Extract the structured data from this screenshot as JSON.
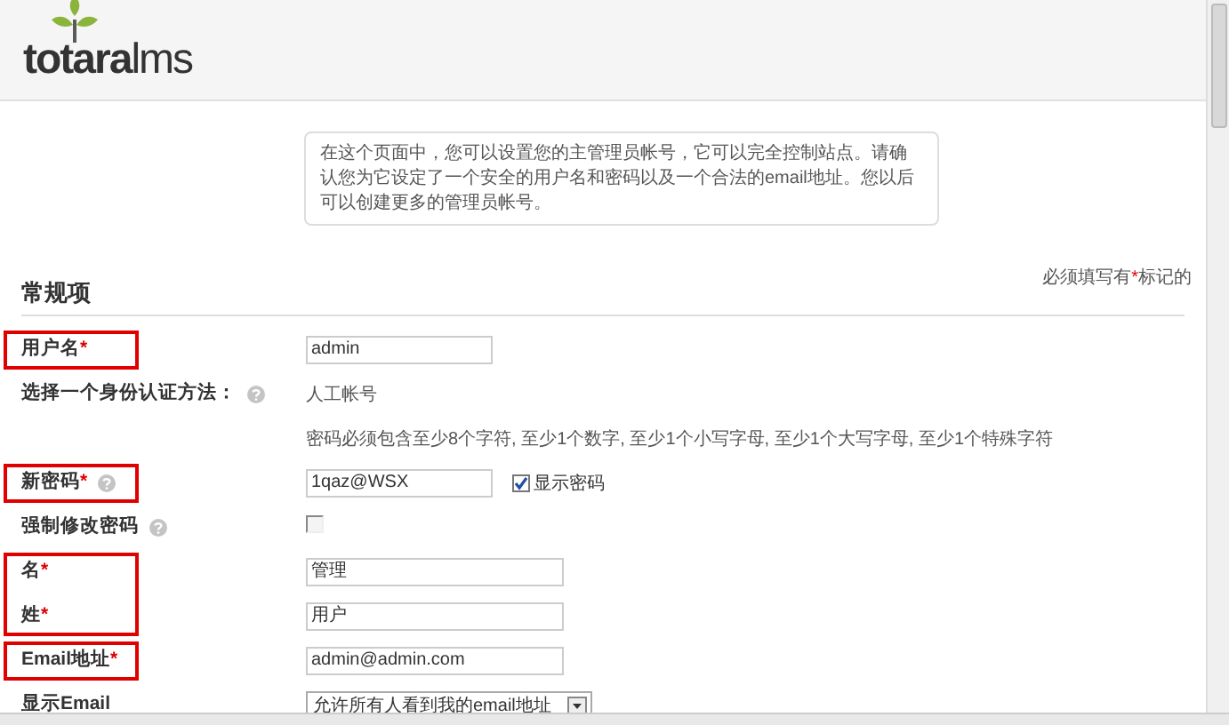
{
  "logo": {
    "text": "totara",
    "suffix": "lms"
  },
  "info": "在这个页面中，您可以设置您的主管理员帐号，它可以完全控制站点。请确认您为它设定了一个安全的用户名和密码以及一个合法的email地址。您以后可以创建更多的管理员帐号。",
  "required_note": {
    "before": "必须填写有",
    "marker": "*",
    "after": "标记的"
  },
  "section": {
    "title": "常规项"
  },
  "groups": [
    {
      "highlighted": true,
      "rows": [
        {
          "label": "用户名",
          "required": true,
          "help": false,
          "kind": "text",
          "value": "admin"
        }
      ]
    },
    {
      "highlighted": false,
      "rows": [
        {
          "label": "选择一个身份认证方法：",
          "required": false,
          "help": true,
          "kind": "static",
          "value": "人工帐号"
        },
        {
          "kind": "hint",
          "value": "密码必须包含至少8个字符, 至少1个数字, 至少1个小写字母, 至少1个大写字母, 至少1个特殊字符"
        }
      ]
    },
    {
      "highlighted": true,
      "rows": [
        {
          "label": "新密码",
          "required": true,
          "help": true,
          "kind": "password",
          "value": "1qaz@WSX",
          "option": {
            "label": "显示密码",
            "checked": true
          }
        }
      ]
    },
    {
      "highlighted": false,
      "rows": [
        {
          "label": "强制修改密码",
          "required": false,
          "help": true,
          "kind": "checkbox",
          "checked": false
        }
      ]
    },
    {
      "highlighted": true,
      "rows": [
        {
          "label": "名",
          "required": true,
          "help": false,
          "kind": "text_wide",
          "value": "管理"
        },
        {
          "label": "姓",
          "required": true,
          "help": false,
          "kind": "text_wide",
          "value": "用户"
        }
      ]
    },
    {
      "highlighted": true,
      "rows": [
        {
          "label": "Email地址",
          "required": true,
          "help": false,
          "kind": "text_wide",
          "value": "admin@admin.com"
        }
      ]
    },
    {
      "highlighted": false,
      "rows": [
        {
          "label": "显示Email",
          "required": false,
          "help": false,
          "kind": "select",
          "value": "允许所有人看到我的email地址"
        }
      ]
    }
  ]
}
